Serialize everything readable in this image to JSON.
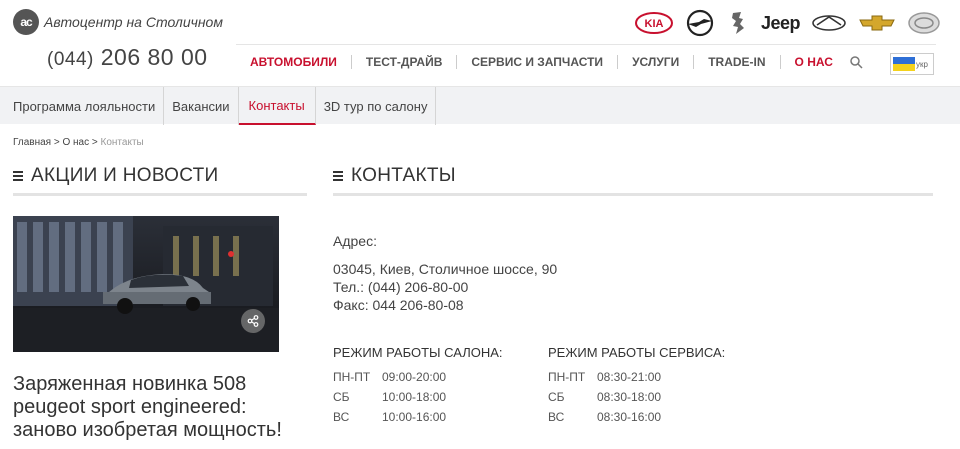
{
  "header": {
    "logo_mark": "ac",
    "logo_text": "Автоцентр на Столичном",
    "phone_code": "(044)",
    "phone_number": "206 80 00",
    "brands": [
      "kia-logo",
      "opel-logo",
      "peugeot-logo",
      "jeep-logo",
      "infiniti-logo",
      "chevrolet-logo",
      "ravon-logo"
    ],
    "jeep_text": "Jeep",
    "kia_text": "KIA",
    "lang": "укр"
  },
  "nav": {
    "items": [
      {
        "label": "АВТОМОБИЛИ",
        "highlight": true
      },
      {
        "label": "ТЕСТ-ДРАЙВ",
        "highlight": false
      },
      {
        "label": "СЕРВИС И ЗАПЧАСТИ",
        "highlight": false
      },
      {
        "label": "УСЛУГИ",
        "highlight": false
      },
      {
        "label": "TRADE-IN",
        "highlight": false
      },
      {
        "label": "О НАС",
        "highlight": true
      }
    ]
  },
  "subnav": {
    "items": [
      {
        "label": "Программа лояльности",
        "active": false
      },
      {
        "label": "Вакансии",
        "active": false
      },
      {
        "label": "Контакты",
        "active": true
      },
      {
        "label": "3D тур по салону",
        "active": false
      }
    ]
  },
  "breadcrumb": {
    "home": "Главная",
    "about": "О нас",
    "current": "Контакты",
    "sep": ">"
  },
  "left": {
    "title": "АКЦИИ И НОВОСТИ",
    "news_title": "Заряженная новинка 508 peugeot sport engineered: заново изобретая мощность!"
  },
  "right": {
    "title": "КОНТАКТЫ",
    "address_label": "Адрес:",
    "address": "03045, Киев, Столичное шоссе, 90",
    "phone": "Тел.: (044) 206-80-00",
    "fax": "Факс: 044 206-80-08",
    "salon": {
      "title": "РЕЖИМ РАБОТЫ САЛОНА:",
      "rows": [
        {
          "day": "ПН-ПТ",
          "time": "09:00-20:00"
        },
        {
          "day": "СБ",
          "time": "10:00-18:00"
        },
        {
          "day": "ВС",
          "time": "10:00-16:00"
        }
      ]
    },
    "service": {
      "title": "РЕЖИМ РАБОТЫ СЕРВИСА:",
      "rows": [
        {
          "day": "ПН-ПТ",
          "time": "08:30-21:00"
        },
        {
          "day": "СБ",
          "time": "08:30-18:00"
        },
        {
          "day": "ВС",
          "time": "08:30-16:00"
        }
      ]
    }
  },
  "colors": {
    "accent": "#c8102e",
    "subnav_bg": "#f1f2f4"
  }
}
